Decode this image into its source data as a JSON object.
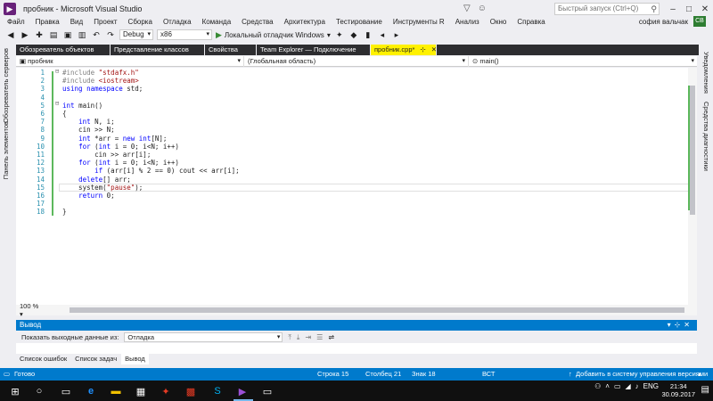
{
  "window": {
    "title": "пробник - Microsoft Visual Studio",
    "quick_launch_placeholder": "Быстрый запуск (Ctrl+Q)",
    "user_name": "софия вальчак",
    "user_badge": "CB"
  },
  "menu": [
    "Файл",
    "Правка",
    "Вид",
    "Проект",
    "Сборка",
    "Отладка",
    "Команда",
    "Средства",
    "Архитектура",
    "Тестирование",
    "Инструменты R",
    "Анализ",
    "Окно",
    "Справка"
  ],
  "toolbar": {
    "config": "Debug",
    "platform": "x86",
    "run_label": "Локальный отладчик Windows"
  },
  "left_strip": [
    "Обозреватель серверов",
    "Панель элементов"
  ],
  "right_strip": [
    "Уведомления",
    "Средства диагностики"
  ],
  "doc_tabs": [
    {
      "label": "Обозреватель объектов"
    },
    {
      "label": "Представление классов"
    },
    {
      "label": "Свойства"
    },
    {
      "label": "Team Explorer — Подключение"
    }
  ],
  "active_tab": "пробник.cpp*",
  "navbar": {
    "project": "пробник",
    "scope": "(Глобальная область)",
    "member": "main()"
  },
  "code": {
    "line_numbers": [
      "1",
      "2",
      "3",
      "4",
      "5",
      "6",
      "7",
      "8",
      "9",
      "10",
      "11",
      "12",
      "13",
      "14",
      "15",
      "16",
      "17",
      "18"
    ],
    "lines": [
      {
        "parts": [
          {
            "t": "#include ",
            "c": "pp"
          },
          {
            "t": "\"stdafx.h\"",
            "c": "inc"
          }
        ]
      },
      {
        "parts": [
          {
            "t": "#include ",
            "c": "pp"
          },
          {
            "t": "<iostream>",
            "c": "inc"
          }
        ]
      },
      {
        "parts": [
          {
            "t": "using ",
            "c": "kw"
          },
          {
            "t": "namespace ",
            "c": "kw"
          },
          {
            "t": "std;",
            "c": ""
          }
        ]
      },
      {
        "parts": []
      },
      {
        "parts": [
          {
            "t": "int ",
            "c": "kw"
          },
          {
            "t": "main()",
            "c": ""
          }
        ]
      },
      {
        "parts": [
          {
            "t": "{",
            "c": ""
          }
        ]
      },
      {
        "parts": [
          {
            "t": "    ",
            "c": ""
          },
          {
            "t": "int ",
            "c": "kw"
          },
          {
            "t": "N, i;",
            "c": ""
          }
        ]
      },
      {
        "parts": [
          {
            "t": "    cin >> N;",
            "c": ""
          }
        ]
      },
      {
        "parts": [
          {
            "t": "    ",
            "c": ""
          },
          {
            "t": "int ",
            "c": "kw"
          },
          {
            "t": "*arr = ",
            "c": ""
          },
          {
            "t": "new ",
            "c": "kw"
          },
          {
            "t": "int",
            "c": "kw"
          },
          {
            "t": "[N];",
            "c": ""
          }
        ]
      },
      {
        "parts": [
          {
            "t": "    ",
            "c": ""
          },
          {
            "t": "for ",
            "c": "kw"
          },
          {
            "t": "(",
            "c": ""
          },
          {
            "t": "int ",
            "c": "kw"
          },
          {
            "t": "i = 0; i<N; i++)",
            "c": ""
          }
        ]
      },
      {
        "parts": [
          {
            "t": "        cin >> arr[i];",
            "c": ""
          }
        ]
      },
      {
        "parts": [
          {
            "t": "    ",
            "c": ""
          },
          {
            "t": "for ",
            "c": "kw"
          },
          {
            "t": "(",
            "c": ""
          },
          {
            "t": "int ",
            "c": "kw"
          },
          {
            "t": "i = 0; i<N; i++)",
            "c": ""
          }
        ]
      },
      {
        "parts": [
          {
            "t": "        ",
            "c": ""
          },
          {
            "t": "if ",
            "c": "kw"
          },
          {
            "t": "(arr[i] % 2 == 0) cout << arr[i];",
            "c": ""
          }
        ]
      },
      {
        "parts": [
          {
            "t": "    ",
            "c": ""
          },
          {
            "t": "delete",
            "c": "kw"
          },
          {
            "t": "[] arr;",
            "c": ""
          }
        ]
      },
      {
        "parts": [
          {
            "t": "    system(",
            "c": ""
          },
          {
            "t": "\"pause\"",
            "c": "str"
          },
          {
            "t": ");",
            "c": ""
          }
        ]
      },
      {
        "parts": [
          {
            "t": "    ",
            "c": ""
          },
          {
            "t": "return ",
            "c": "kw"
          },
          {
            "t": "0;",
            "c": ""
          }
        ]
      },
      {
        "parts": []
      },
      {
        "parts": [
          {
            "t": "}",
            "c": ""
          }
        ]
      }
    ]
  },
  "zoom": "100 %",
  "output": {
    "title": "Вывод",
    "source_label": "Показать выходные данные из:",
    "source_value": "Отладка"
  },
  "bottom_tabs": [
    "Список ошибок",
    "Список задач",
    "Вывод"
  ],
  "status": {
    "ready": "Готово",
    "row": "Строка 15",
    "col": "Столбец 21",
    "ch": "Знак 18",
    "mode": "ВСТ",
    "vcs": "Добавить в систему управления версиями"
  },
  "taskbar": {
    "lang": "ENG",
    "time": "21:34",
    "date": "30.09.2017"
  },
  "colors": {
    "accent": "#007acc",
    "active_tab": "#fff100",
    "keyword": "#0000ff",
    "string": "#a31515",
    "line_number": "#2b91af"
  }
}
